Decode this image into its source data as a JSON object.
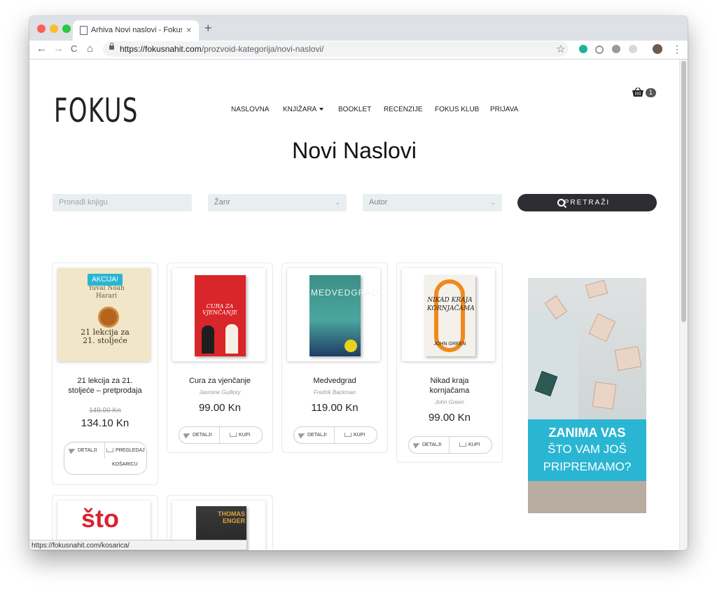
{
  "browser": {
    "tab_title": "Arhiva Novi naslovi - FokusNahit",
    "tab_close": "×",
    "new_tab": "+",
    "url_host": "https://fokusnahit.com",
    "url_path": "/prozvoid-kategorija/novi-naslovi/",
    "back": "←",
    "forward": "→",
    "reload": "C",
    "home": "⌂",
    "star": "☆",
    "menu": "⋮",
    "status_url": "https://fokusnahit.com/kosarica/"
  },
  "site": {
    "logo": "FOKUS",
    "nav": {
      "naslovna": "NASLOVNA",
      "knjizara": "KNJIŽARA",
      "booklet": "BOOKLET",
      "recenzije": "RECENZIJE",
      "fokus_klub": "FOKUS KLUB",
      "prijava": "PRIJAVA"
    },
    "cart_count": "1"
  },
  "page": {
    "title": "Novi Naslovi"
  },
  "filters": {
    "search_placeholder": "Pronađi knjigu",
    "genre": "Žanr",
    "author": "Autor",
    "chevron": "⌄",
    "search_button": "PRETRAŽI"
  },
  "products": [
    {
      "title_line1": "21 lekcija za 21.",
      "title_line2": "stoljeće – pretprodaja",
      "old_price": "149.00 Kn",
      "price": "134.10 Kn",
      "badge": "AKCIJA!",
      "btn_details": "DETALJI",
      "btn_cart_line1": "PREGLEDAJ",
      "btn_cart_line2": "KOŠARICU",
      "cover_author": "Yuval Noah Harari",
      "cover_title": "21 lekcija za 21. stoljeće"
    },
    {
      "title": "Cura za vjenčanje",
      "author": "Jasmine Guillory",
      "price": "99.00 Kn",
      "btn_details": "DETALJI",
      "btn_buy": "KUPI",
      "cover_title": "CURA ZA VJENČANJE"
    },
    {
      "title": "Medvedgrad",
      "author": "Fredrik Backman",
      "price": "119.00 Kn",
      "btn_details": "DETALJI",
      "btn_buy": "KUPI",
      "cover_title": "MEDVEDGRAD"
    },
    {
      "title_line1": "Nikad kraja",
      "title_line2": "kornjačama",
      "author": "John Green",
      "price": "99.00 Kn",
      "btn_details": "DETALJI",
      "btn_buy": "KUPI",
      "cover_title": "NIKAD KRAJA KORNJAČAMA",
      "cover_author": "JOHN GREEN"
    },
    {
      "cover_title": "što"
    },
    {
      "cover_author": "THOMAS ENGER"
    }
  ],
  "ad": {
    "line1": "ZANIMA VAS",
    "line2": "ŠTO VAM JOŠ",
    "line3": "PRIPREMAMO?"
  },
  "colors": {
    "accent": "#29b6d4",
    "dark_button": "#2d2d33"
  }
}
